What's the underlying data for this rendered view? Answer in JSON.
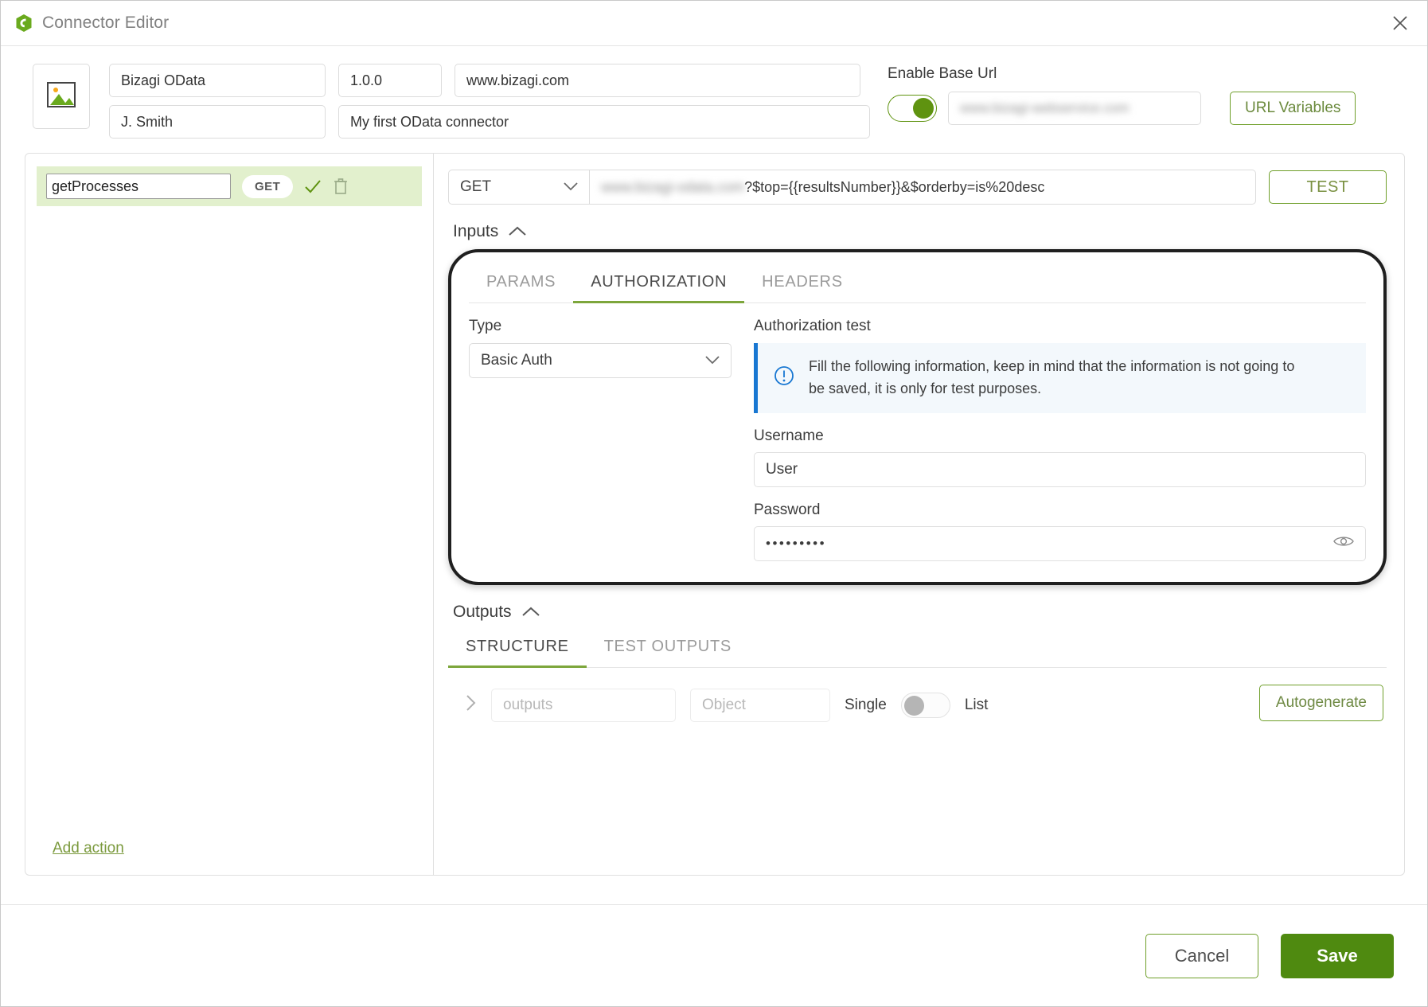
{
  "window": {
    "title": "Connector Editor",
    "close_label": "✕"
  },
  "header": {
    "connector_name": "Bizagi OData",
    "version": "1.0.0",
    "website": "www.bizagi.com",
    "author": "J. Smith",
    "description": "My first OData connector",
    "enable_base_url_label": "Enable Base Url",
    "base_url_redacted": "www.bizagi-webservice.com",
    "url_variables_label": "URL Variables",
    "toggle_on": true
  },
  "actions_panel": {
    "items": [
      {
        "name": "getProcesses",
        "verb": "GET",
        "selected": true
      }
    ],
    "add_action_label": "Add action"
  },
  "request": {
    "method": "GET",
    "url_redacted": "www.bizagi-odata.com",
    "url_query": "?$top={{resultsNumber}}&$orderby=is%20desc",
    "test_label": "TEST"
  },
  "inputs": {
    "section_label": "Inputs",
    "collapsed": false,
    "tabs": [
      {
        "label": "PARAMS",
        "active": false
      },
      {
        "label": "AUTHORIZATION",
        "active": true
      },
      {
        "label": "HEADERS",
        "active": false
      }
    ],
    "authorization": {
      "type_label": "Type",
      "type_value": "Basic Auth",
      "test_label": "Authorization test",
      "info_message": "Fill the following information, keep in mind that the information is not going to be saved, it is only for test purposes.",
      "username_label": "Username",
      "username_value": "User",
      "password_label": "Password",
      "password_value": "•••••••••"
    }
  },
  "outputs": {
    "section_label": "Outputs",
    "collapsed": false,
    "tabs": [
      {
        "label": "STRUCTURE",
        "active": true
      },
      {
        "label": "TEST OUTPUTS",
        "active": false
      }
    ],
    "row": {
      "name_placeholder": "outputs",
      "type_placeholder": "Object",
      "single_label": "Single",
      "list_label": "List",
      "is_list": false
    },
    "autogenerate_label": "Autogenerate"
  },
  "footer": {
    "cancel_label": "Cancel",
    "save_label": "Save"
  },
  "colors": {
    "accent_green": "#5f9310",
    "save_green": "#4f8a10",
    "info_blue": "#1877d2",
    "selected_row": "#e2f0cd"
  }
}
